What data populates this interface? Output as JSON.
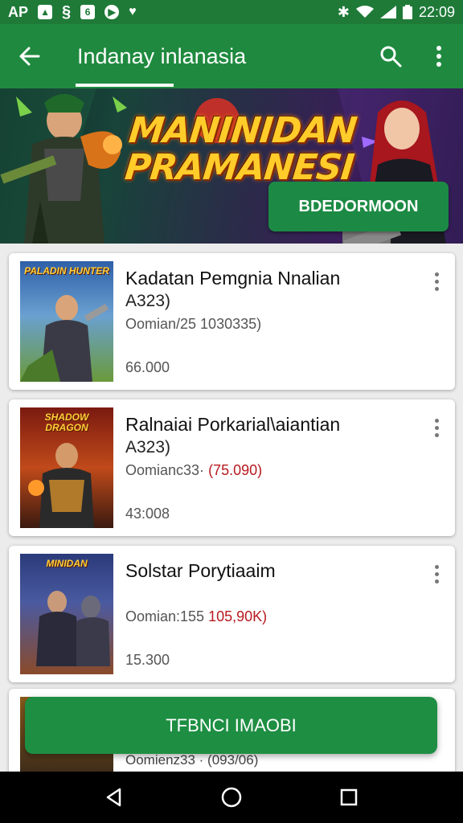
{
  "status_bar": {
    "carrier": "AP",
    "icons": [
      "gallery-icon",
      "s-app-icon",
      "six-app-icon",
      "play-icon",
      "shield-icon"
    ],
    "time": "22:09",
    "right_icons": [
      "bluetooth-icon",
      "wifi-icon",
      "signal-icon",
      "battery-icon"
    ]
  },
  "app_bar": {
    "title": "Indanay inlanasia",
    "icons": [
      "back-arrow-icon",
      "search-icon",
      "more-vert-icon"
    ]
  },
  "banner": {
    "title_line1": "MANINIDAN",
    "title_line2": "PRAMANESI",
    "button_label": "BDEDORMOON"
  },
  "items": [
    {
      "title": "Kadatan Pemgnia Nnalian",
      "subtitle": "A323)",
      "meta": "Oomian/25 1030335)",
      "meta_highlight": "",
      "price": "66.000",
      "thumb_caption": "PALADIN HUNTER",
      "thumb_colors": [
        "#2e5fa8",
        "#6a9a3a"
      ]
    },
    {
      "title": "Ralnaiai Porkarial\\aiantian",
      "subtitle": "A323)",
      "meta": "Oomianc33·",
      "meta_highlight": "(75.090)",
      "price": "43:008",
      "thumb_caption": "SHADOW DRAGON",
      "thumb_colors": [
        "#7a1a10",
        "#d8702a"
      ]
    },
    {
      "title": "Solstar Porytiaaim",
      "subtitle": "",
      "meta": "Oomian:155",
      "meta_highlight": "105,90K)",
      "price": "15.300",
      "thumb_caption": "MINIDAN",
      "thumb_colors": [
        "#2a3a7a",
        "#8a4a2a"
      ]
    }
  ],
  "peek_item": {
    "meta": "Oomienz33 · (093/06)"
  },
  "floating_button": {
    "label": "TFBNCI IMAOBI"
  },
  "nav_bar": {
    "icons": [
      "back-triangle-icon",
      "home-circle-icon",
      "recents-square-icon"
    ]
  },
  "colors": {
    "app_bar": "#1f8a3f",
    "button_green": "#1e8e43",
    "highlight_red": "#b8191f"
  }
}
